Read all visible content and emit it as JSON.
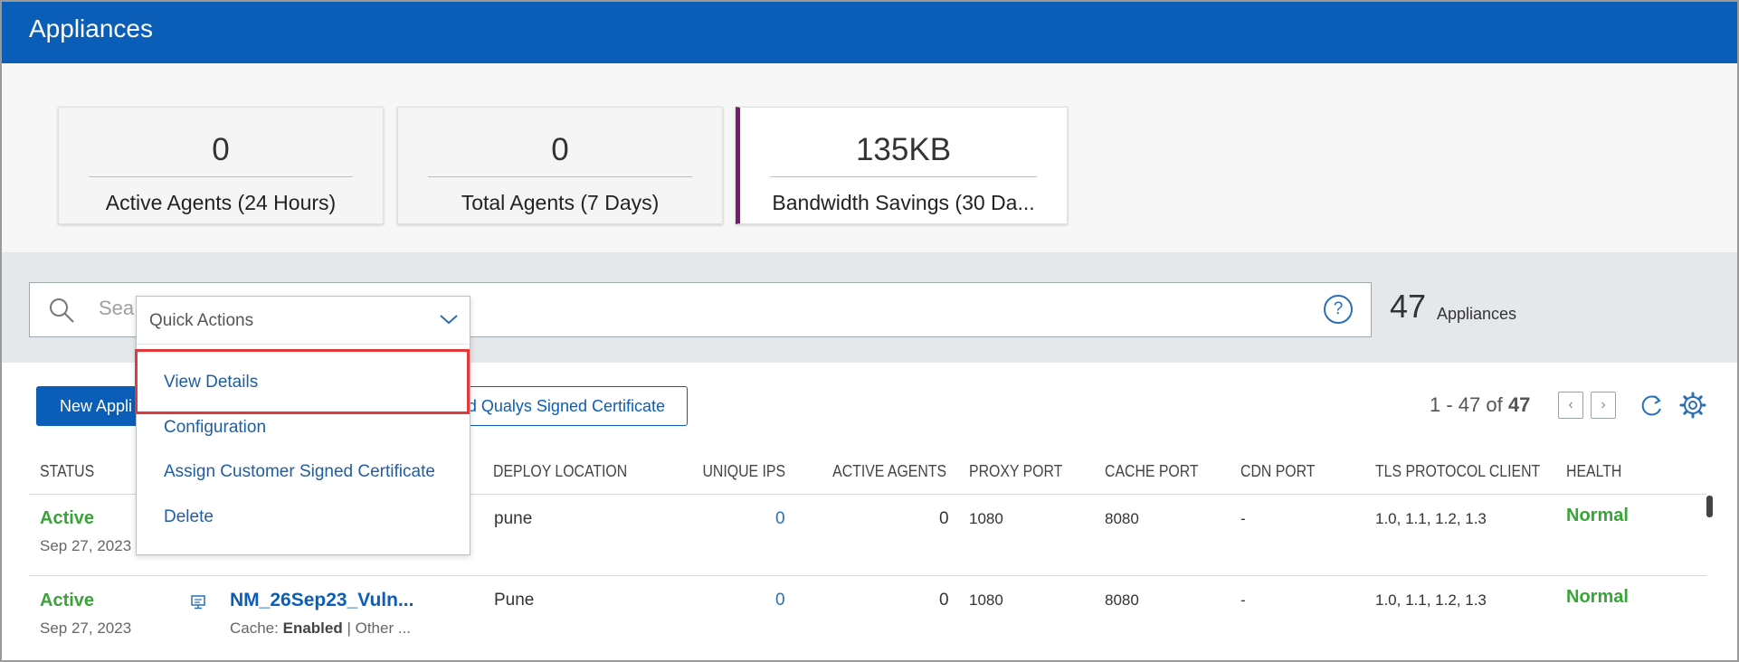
{
  "header": {
    "title": "Appliances"
  },
  "kpis": [
    {
      "value": "0",
      "label": "Active Agents (24 Hours)"
    },
    {
      "value": "0",
      "label": "Total Agents (7 Days)"
    },
    {
      "value": "135KB",
      "label": "Bandwidth Savings (30 Da..."
    }
  ],
  "search": {
    "placeholder": "Sea",
    "count": "47",
    "count_label": "Appliances"
  },
  "toolbar": {
    "new_label": "New Appli",
    "cert_label": "d Qualys Signed Certificate",
    "pager_range": "1 - 47 of",
    "pager_total": "47"
  },
  "quick_actions": {
    "title": "Quick Actions",
    "items": [
      "View Details",
      "Configuration",
      "Assign Customer Signed Certificate",
      "Delete"
    ]
  },
  "table": {
    "headers": {
      "status": "STATUS",
      "deploy_location": "DEPLOY LOCATION",
      "unique_ips": "UNIQUE IPS",
      "active_agents": "ACTIVE AGENTS",
      "proxy_port": "PROXY PORT",
      "cache_port": "CACHE PORT",
      "cdn_port": "CDN PORT",
      "tls": "TLS PROTOCOL CLIENT",
      "health": "HEALTH"
    },
    "rows": [
      {
        "status": "Active",
        "date": "Sep 27, 2023",
        "name": "",
        "cache_label": "",
        "cache_value": "",
        "other": "",
        "location": "pune",
        "unique_ips": "0",
        "active_agents": "0",
        "proxy_port": "1080",
        "cache_port": "8080",
        "cdn_port": "-",
        "tls": "1.0, 1.1, 1.2, 1.3",
        "health": "Normal"
      },
      {
        "status": "Active",
        "date": "Sep 27, 2023",
        "name": "NM_26Sep23_Vuln...",
        "cache_label": "Cache:",
        "cache_value": "Enabled",
        "other": "| Other ...",
        "location": "Pune",
        "unique_ips": "0",
        "active_agents": "0",
        "proxy_port": "1080",
        "cache_port": "8080",
        "cdn_port": "-",
        "tls": "1.0, 1.1, 1.2, 1.3",
        "health": "Normal"
      }
    ]
  },
  "colors": {
    "brand": "#0b5eb7",
    "active_status": "#3aa33a",
    "highlight": "#e03a3a",
    "card_accent": "#7a1a6f"
  },
  "icons": [
    "search-icon",
    "help-icon",
    "chevron-left-icon",
    "chevron-right-icon",
    "refresh-icon",
    "gear-icon",
    "chevron-down-icon",
    "appliance-icon"
  ]
}
